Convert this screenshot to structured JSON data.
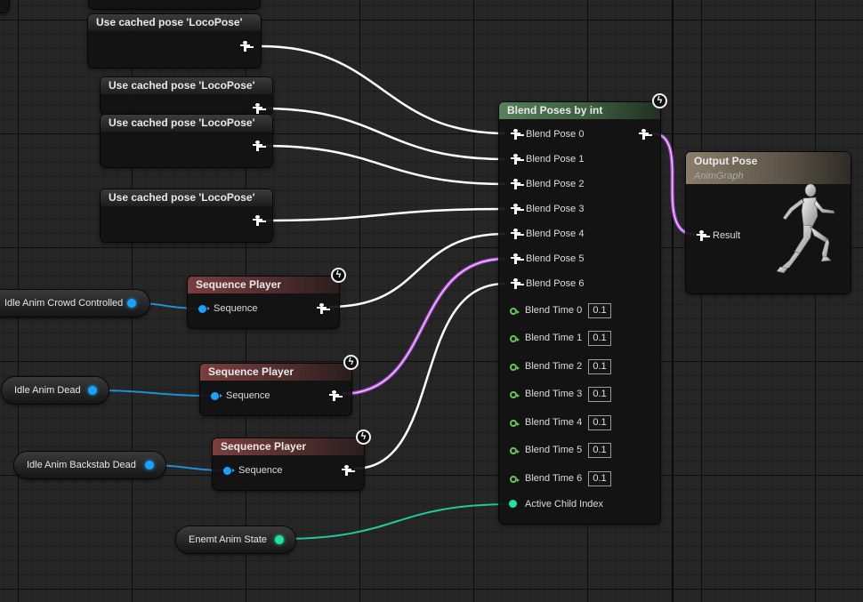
{
  "cached_pose_nodes": [
    {
      "title": "Use cached pose 'LocoPose'"
    },
    {
      "title": "Use cached pose 'LocoPose'"
    },
    {
      "title": "Use cached pose 'LocoPose'"
    },
    {
      "title": "Use cached pose 'LocoPose'"
    }
  ],
  "sequence_players": [
    {
      "title": "Sequence Player",
      "pin_label": "Sequence"
    },
    {
      "title": "Sequence Player",
      "pin_label": "Sequence"
    },
    {
      "title": "Sequence Player",
      "pin_label": "Sequence"
    }
  ],
  "variables": [
    {
      "label": "Idle Anim Crowd Controlled"
    },
    {
      "label": "Idle Anim Dead"
    },
    {
      "label": "Idle Anim Backstab Dead"
    },
    {
      "label": "Enemt Anim State"
    }
  ],
  "blend_node": {
    "title": "Blend Poses by int",
    "pose_pins": [
      "Blend Pose 0",
      "Blend Pose 1",
      "Blend Pose 2",
      "Blend Pose 3",
      "Blend Pose 4",
      "Blend Pose 5",
      "Blend Pose 6"
    ],
    "time_pins": [
      {
        "label": "Blend Time 0",
        "value": "0.1"
      },
      {
        "label": "Blend Time 1",
        "value": "0.1"
      },
      {
        "label": "Blend Time 2",
        "value": "0.1"
      },
      {
        "label": "Blend Time 3",
        "value": "0.1"
      },
      {
        "label": "Blend Time 4",
        "value": "0.1"
      },
      {
        "label": "Blend Time 5",
        "value": "0.1"
      },
      {
        "label": "Blend Time 6",
        "value": "0.1"
      }
    ],
    "index_pin": "Active Child Index"
  },
  "output_node": {
    "title": "Output Pose",
    "subtitle": "AnimGraph",
    "result_label": "Result"
  },
  "icons": {
    "fast_path": "lightning-bolt-icon",
    "pose_pin": "pose-person-icon",
    "float_pin": "float-pin-icon"
  },
  "colors": {
    "wire_pose": "#ffffff",
    "wire_selected": "#b04adf",
    "wire_object": "#19a2ff",
    "wire_int": "#22c9a0",
    "header_blend": "#56805a",
    "header_sequence": "#7a3e3e",
    "header_output": "#8a7e6a"
  }
}
